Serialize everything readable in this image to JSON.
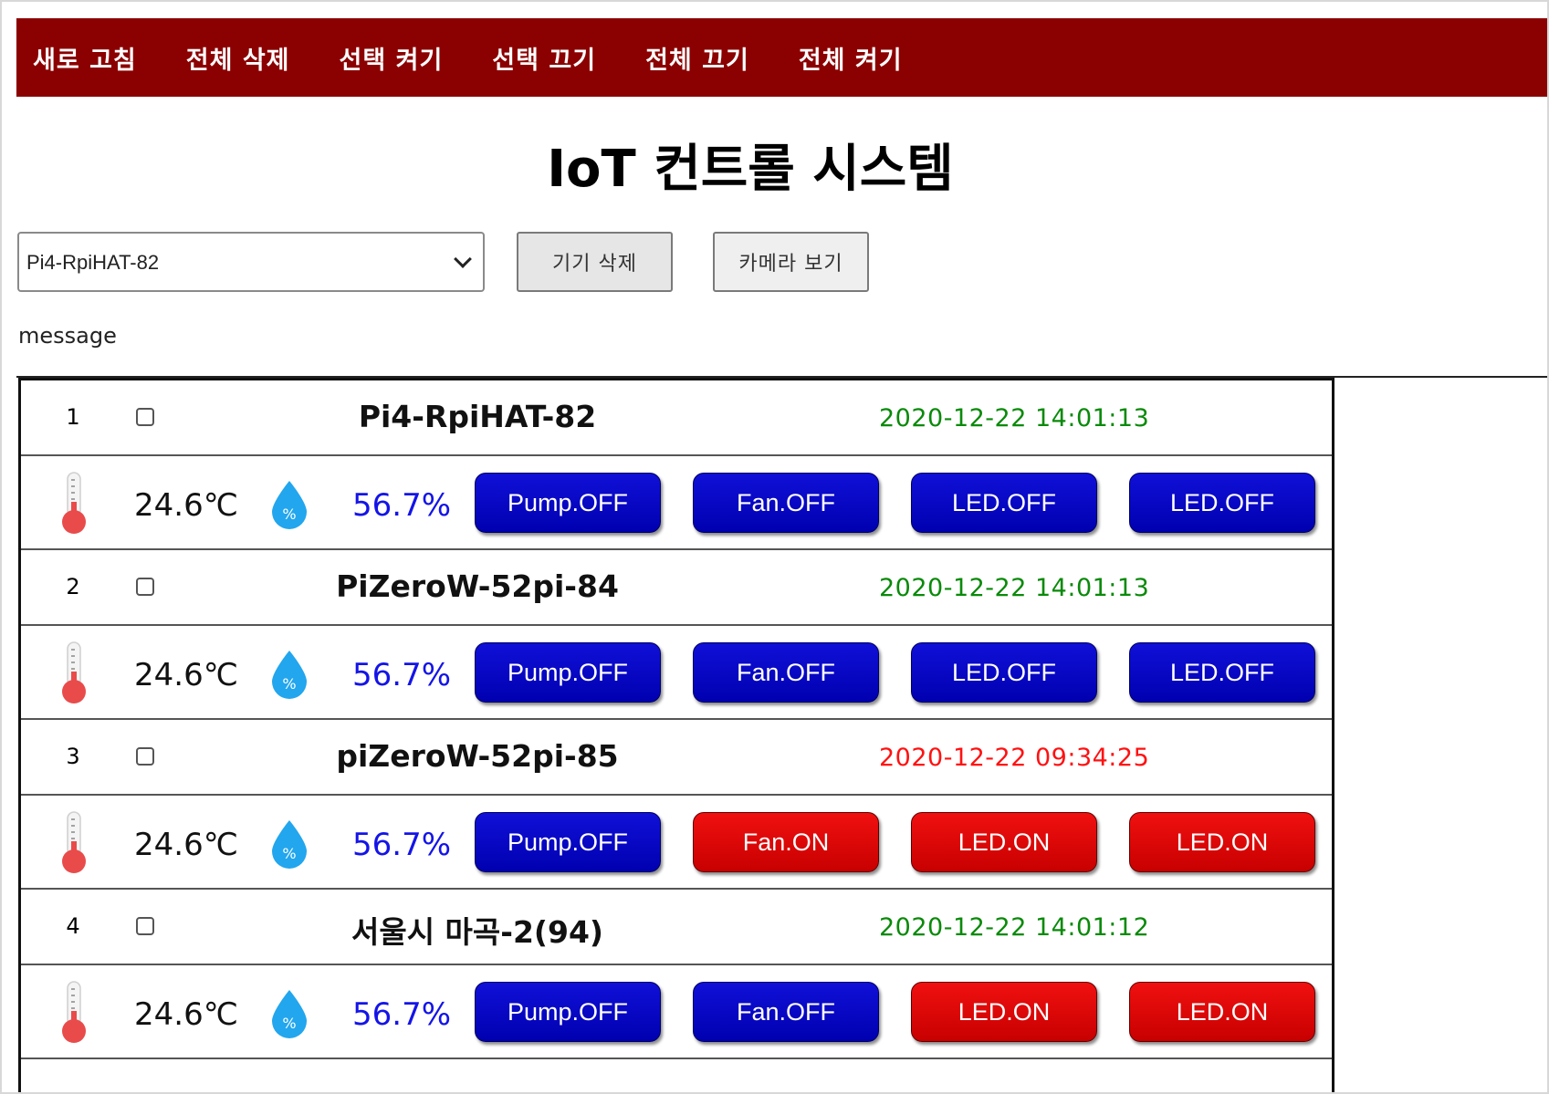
{
  "nav": {
    "items": [
      "새로 고침",
      "전체 삭제",
      "선택 켜기",
      "선택 끄기",
      "전체 끄기",
      "전체 켜기"
    ]
  },
  "title": "IoT 컨트롤 시스템",
  "device_select": {
    "selected": "Pi4-RpiHAT-82"
  },
  "buttons": {
    "delete_device": "기기 삭제",
    "view_camera": "카메라 보기"
  },
  "message": "message",
  "colors": {
    "nav_bg": "#8b0000",
    "time_ok": "#0a8a0a",
    "time_stale": "#ff1111",
    "btn_off": "#0000c8",
    "btn_on": "#e00000",
    "humidity": "#1414e8"
  },
  "icons": {
    "temperature": "thermometer-icon",
    "humidity": "humidity-drop-icon"
  },
  "devices": [
    {
      "num": "1",
      "name": "Pi4-RpiHAT-82",
      "time": "2020-12-22 14:01:13",
      "time_status": "ok",
      "temp": "24.6℃",
      "humidity": "56.7%",
      "controls": [
        {
          "label": "Pump.OFF",
          "state": "off"
        },
        {
          "label": "Fan.OFF",
          "state": "off"
        },
        {
          "label": "LED.OFF",
          "state": "off"
        },
        {
          "label": "LED.OFF",
          "state": "off"
        }
      ]
    },
    {
      "num": "2",
      "name": "PiZeroW-52pi-84",
      "time": "2020-12-22 14:01:13",
      "time_status": "ok",
      "temp": "24.6℃",
      "humidity": "56.7%",
      "controls": [
        {
          "label": "Pump.OFF",
          "state": "off"
        },
        {
          "label": "Fan.OFF",
          "state": "off"
        },
        {
          "label": "LED.OFF",
          "state": "off"
        },
        {
          "label": "LED.OFF",
          "state": "off"
        }
      ]
    },
    {
      "num": "3",
      "name": "piZeroW-52pi-85",
      "time": "2020-12-22 09:34:25",
      "time_status": "stale",
      "temp": "24.6℃",
      "humidity": "56.7%",
      "controls": [
        {
          "label": "Pump.OFF",
          "state": "off"
        },
        {
          "label": "Fan.ON",
          "state": "on"
        },
        {
          "label": "LED.ON",
          "state": "on"
        },
        {
          "label": "LED.ON",
          "state": "on"
        }
      ]
    },
    {
      "num": "4",
      "name": "서울시 마곡-2(94)",
      "time": "2020-12-22 14:01:12",
      "time_status": "ok",
      "temp": "24.6℃",
      "humidity": "56.7%",
      "controls": [
        {
          "label": "Pump.OFF",
          "state": "off"
        },
        {
          "label": "Fan.OFF",
          "state": "off"
        },
        {
          "label": "LED.ON",
          "state": "on"
        },
        {
          "label": "LED.ON",
          "state": "on"
        }
      ]
    }
  ]
}
